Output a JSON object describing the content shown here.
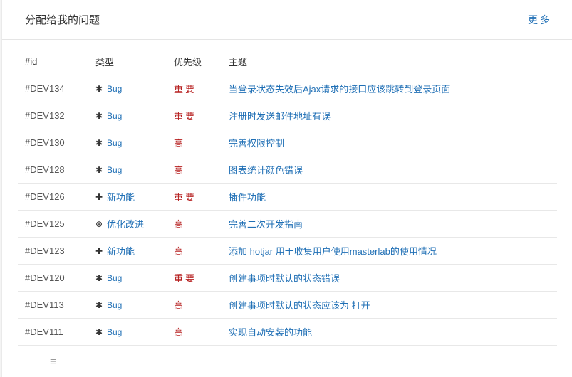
{
  "panel": {
    "title": "分配给我的问题",
    "more_label": "更多"
  },
  "table": {
    "headers": [
      "#id",
      "类型",
      "优先级",
      "主题"
    ],
    "rows": [
      {
        "id": "#DEV134",
        "type": "Bug",
        "type_icon": "bug-icon",
        "priority": "重要",
        "subject": "当登录状态失效后Ajax请求的接口应该跳转到登录页面"
      },
      {
        "id": "#DEV132",
        "type": "Bug",
        "type_icon": "bug-icon",
        "priority": "重要",
        "subject": "注册时发送邮件地址有误"
      },
      {
        "id": "#DEV130",
        "type": "Bug",
        "type_icon": "bug-icon",
        "priority": "高",
        "subject": "完善权限控制"
      },
      {
        "id": "#DEV128",
        "type": "Bug",
        "type_icon": "bug-icon",
        "priority": "高",
        "subject": "图表统计颜色错误"
      },
      {
        "id": "#DEV126",
        "type": "新功能",
        "type_icon": "plus-icon",
        "priority": "重要",
        "subject": "插件功能"
      },
      {
        "id": "#DEV125",
        "type": "优化改进",
        "type_icon": "arrow-up-circle-icon",
        "priority": "高",
        "subject": "完善二次开发指南"
      },
      {
        "id": "#DEV123",
        "type": "新功能",
        "type_icon": "plus-icon",
        "priority": "高",
        "subject": "添加 hotjar 用于收集用户使用masterlab的使用情况"
      },
      {
        "id": "#DEV120",
        "type": "Bug",
        "type_icon": "bug-icon",
        "priority": "重要",
        "subject": "创建事项时默认的状态错误"
      },
      {
        "id": "#DEV113",
        "type": "Bug",
        "type_icon": "bug-icon",
        "priority": "高",
        "subject": "创建事项时默认的状态应该为 打开"
      },
      {
        "id": "#DEV111",
        "type": "Bug",
        "type_icon": "bug-icon",
        "priority": "高",
        "subject": "实现自动安装的功能"
      }
    ]
  },
  "colors": {
    "link": "#1f6fb5",
    "priority": "#b61e1e"
  },
  "footer": {
    "menu_icon": "hamburger-icon"
  }
}
